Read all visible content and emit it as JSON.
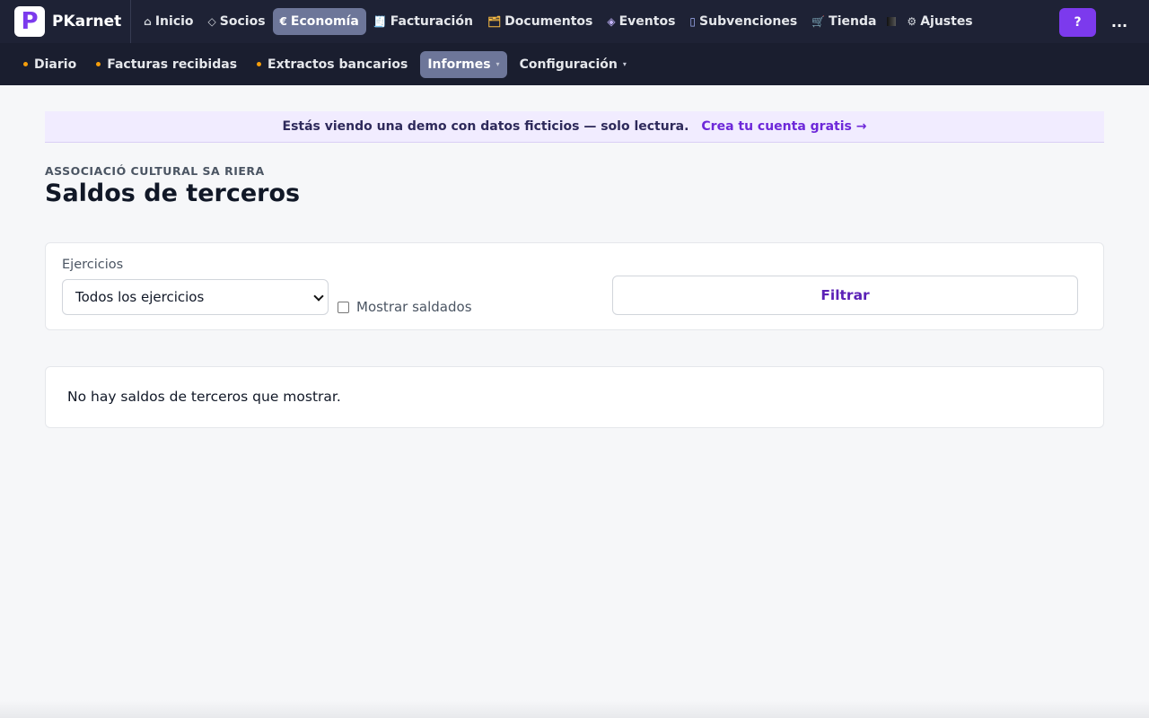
{
  "app": {
    "name": "PKarnet",
    "logo_letter": "P"
  },
  "topnav": {
    "items": [
      {
        "icon": "home-icon",
        "glyph": "⌂",
        "label": "Inicio",
        "active": false
      },
      {
        "icon": "diamond-icon",
        "glyph": "◇",
        "label": "Socios",
        "active": false
      },
      {
        "icon": "euro-icon",
        "glyph": "€",
        "label": "Economía",
        "active": true
      },
      {
        "icon": "receipt-icon",
        "glyph": "🧾",
        "label": "Facturación",
        "active": false
      },
      {
        "icon": "folder-icon",
        "glyph": "🗂",
        "label": "Documentos",
        "active": false
      },
      {
        "icon": "event-icon",
        "glyph": "◈",
        "label": "Eventos",
        "active": false
      },
      {
        "icon": "columns-icon",
        "glyph": "▯",
        "label": "Subvenciones",
        "active": false
      },
      {
        "icon": "cart-icon",
        "glyph": "🛒",
        "label": "Tienda",
        "active": false
      },
      {
        "icon": "gear-icon",
        "glyph": "⚙",
        "label": "Ajustes",
        "active": false
      }
    ],
    "help_label": "?",
    "more_label": "..."
  },
  "subnav": {
    "items": [
      {
        "label": "Diario",
        "dot": true,
        "caret": false,
        "active": false
      },
      {
        "label": "Facturas recibidas",
        "dot": true,
        "caret": false,
        "active": false
      },
      {
        "label": "Extractos bancarios",
        "dot": true,
        "caret": false,
        "active": false
      },
      {
        "label": "Informes",
        "dot": false,
        "caret": true,
        "active": true
      },
      {
        "label": "Configuración",
        "dot": false,
        "caret": true,
        "active": false
      }
    ],
    "caret_glyph": "▾"
  },
  "banner": {
    "message": "Estás viendo una demo con datos ficticios — solo lectura.",
    "cta": "Crea tu cuenta gratis →"
  },
  "page": {
    "organization": "ASSOCIACIÓ CULTURAL SA RIERA",
    "title": "Saldos de terceros"
  },
  "filters": {
    "year_label": "Ejercicios",
    "year_value": "Todos los ejercicios",
    "show_settled_label": "Mostrar saldados",
    "show_settled_checked": false,
    "filter_button": "Filtrar"
  },
  "results": {
    "empty_message": "No hay saldos de terceros que mostrar."
  },
  "colors": {
    "topbar": "#1e2235",
    "subbar": "#1a1e2f",
    "active_tab": "#6d7699",
    "accent": "#7c3aed",
    "banner_bg": "#f1ecff",
    "dot": "#f59e0b"
  }
}
